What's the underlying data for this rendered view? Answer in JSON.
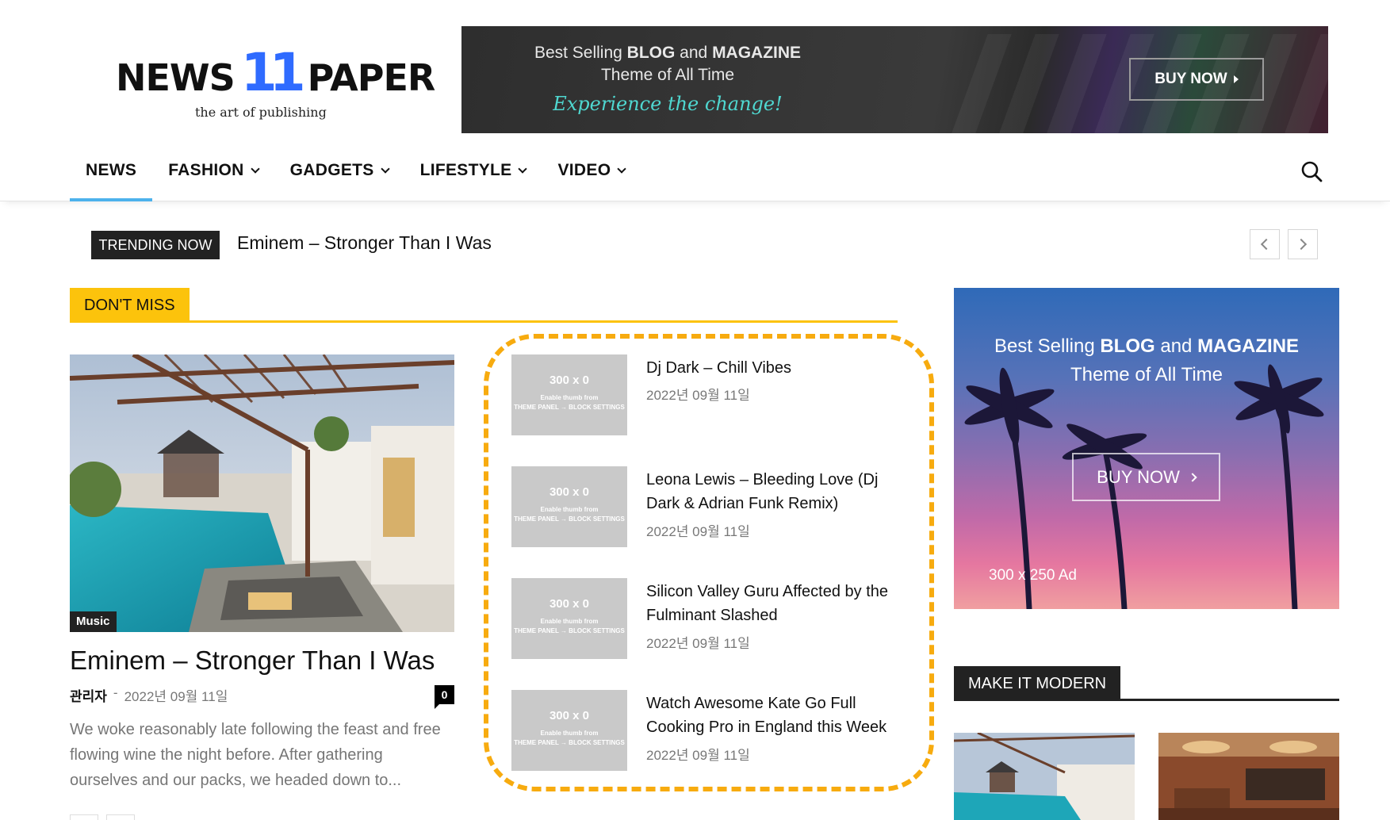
{
  "header": {
    "logo": {
      "word_left": "NEWS",
      "number": "11",
      "word_right": "PAPER",
      "tagline": "the art of publishing"
    },
    "banner": {
      "line1_pre": "Best Selling ",
      "line1_bold1": "BLOG",
      "line1_mid": " and ",
      "line1_bold2": "MAGAZINE",
      "line2": "Theme of All Time",
      "line3": "Experience the change!",
      "button": "BUY NOW"
    }
  },
  "nav": {
    "items": [
      {
        "label": "NEWS",
        "active": true,
        "dropdown": false
      },
      {
        "label": "FASHION",
        "dropdown": true
      },
      {
        "label": "GADGETS",
        "dropdown": true
      },
      {
        "label": "LIFESTYLE",
        "dropdown": true
      },
      {
        "label": "VIDEO",
        "dropdown": true
      }
    ],
    "search_icon": "search-icon",
    "accent_color": "#4db2ec"
  },
  "trending": {
    "label": "TRENDING NOW",
    "title": "Eminem – Stronger Than I Was"
  },
  "dont_miss": {
    "heading": "DON'T MISS",
    "accent_color": "#fcc30c",
    "featured": {
      "category": "Music",
      "title": "Eminem – Stronger Than I Was",
      "author": "관리자",
      "separator": "-",
      "date": "2022년 09월 11일",
      "comments": "0",
      "excerpt": "We woke reasonably late following the feast and free flowing wine the night before. After gathering ourselves and our packs, we headed down to..."
    },
    "list": [
      {
        "title": "Dj Dark – Chill Vibes",
        "date": "2022년 09월 11일",
        "thumb_size": "300 x 0",
        "thumb_note": "Enable thumb from",
        "thumb_path": "THEME PANEL → BLOCK SETTINGS"
      },
      {
        "title": "Leona Lewis – Bleeding Love (Dj Dark & Adrian Funk Remix)",
        "date": "2022년 09월 11일",
        "thumb_size": "300 x 0",
        "thumb_note": "Enable thumb from",
        "thumb_path": "THEME PANEL → BLOCK SETTINGS"
      },
      {
        "title": "Silicon Valley Guru Affected by the Fulminant Slashed",
        "date": "2022년 09월 11일",
        "thumb_size": "300 x 0",
        "thumb_note": "Enable thumb from",
        "thumb_path": "THEME PANEL → BLOCK SETTINGS"
      },
      {
        "title": "Watch Awesome Kate Go Full Cooking Pro in England this Week",
        "date": "2022년 09월 11일",
        "thumb_size": "300 x 0",
        "thumb_note": "Enable thumb from",
        "thumb_path": "THEME PANEL → BLOCK SETTINGS"
      }
    ],
    "highlight_color": "#f7ab0f"
  },
  "sidebar": {
    "ad": {
      "line1_pre": "Best Selling ",
      "line1_bold1": "BLOG",
      "line1_mid": " and ",
      "line1_bold2": "MAGAZINE",
      "line2": "Theme of All Time",
      "button": "BUY NOW",
      "size": "300 x 250 Ad"
    },
    "make_it_modern": {
      "heading": "MAKE IT MODERN"
    }
  }
}
